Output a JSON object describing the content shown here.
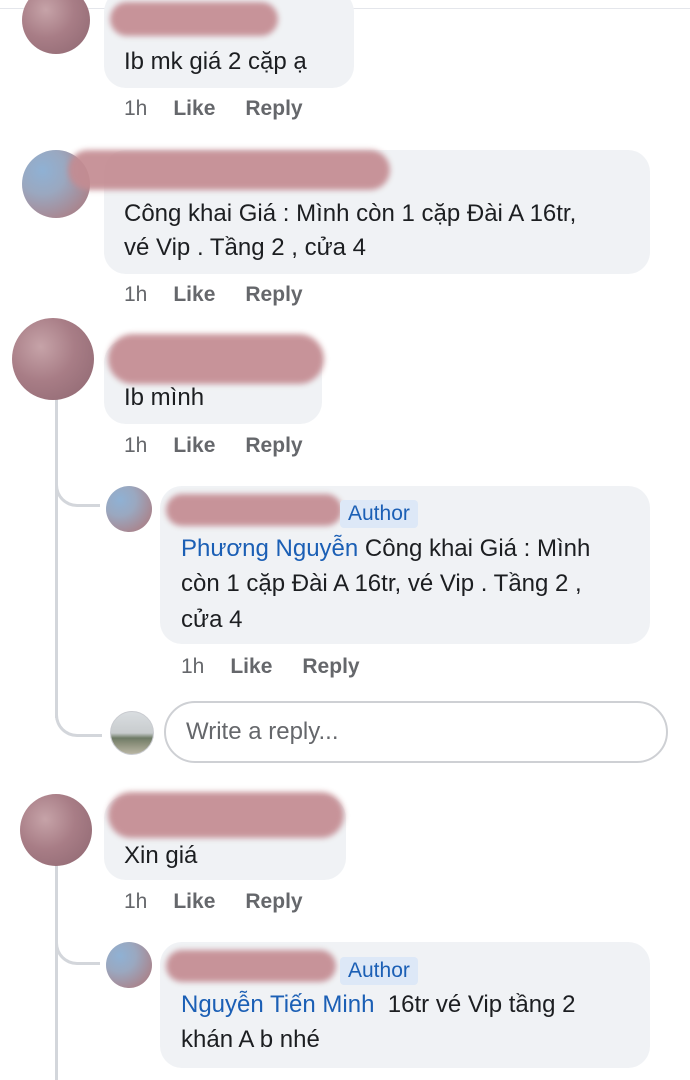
{
  "comments": [
    {
      "text": "Ib mk giá 2 cặp ạ",
      "time": "1h",
      "like": "Like",
      "reply": "Reply"
    },
    {
      "text_line1": "Công khai Giá : Mình còn 1 cặp Đài A 16tr,",
      "text_line2": "vé Vip . Tầng 2 , cửa 4",
      "time": "1h",
      "like": "Like",
      "reply": "Reply"
    },
    {
      "text": "Ib mình",
      "time": "1h",
      "like": "Like",
      "reply": "Reply",
      "reply_item": {
        "badge": "Author",
        "mention": "Phương Nguyễn",
        "line1": " Công khai Giá : Mình",
        "line2": "còn 1 cặp Đài A 16tr, vé Vip . Tầng 2 ,",
        "line3": "cửa 4",
        "time": "1h",
        "like": "Like",
        "reply": "Reply"
      },
      "write_reply_placeholder": "Write a reply..."
    },
    {
      "text": "Xin giá",
      "time": "1h",
      "like": "Like",
      "reply": "Reply",
      "reply_item": {
        "badge": "Author",
        "mention": "Nguyễn Tiến Minh",
        "line1": "  16tr vé Vip tầng 2",
        "line2": "khán A b nhé"
      }
    }
  ]
}
